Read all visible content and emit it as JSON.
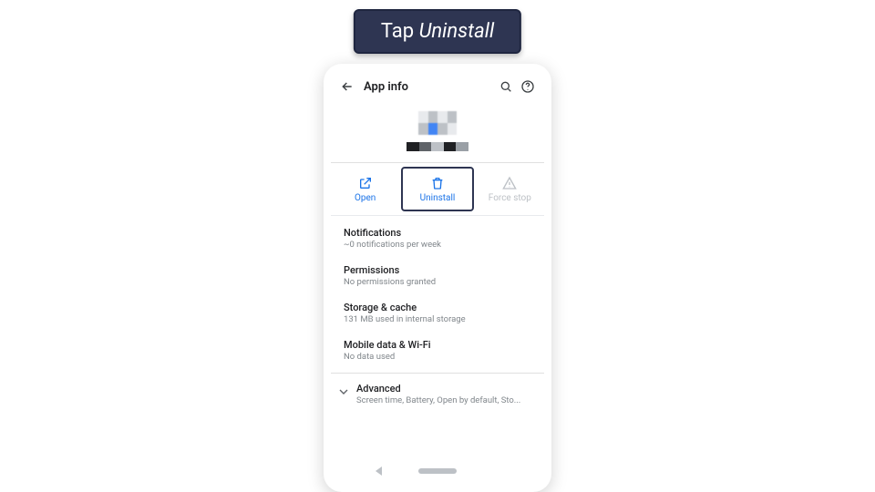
{
  "callout": {
    "prefix": "Tap ",
    "emph": "Uninstall"
  },
  "appbar": {
    "title": "App info"
  },
  "actions": {
    "open": "Open",
    "uninstall": "Uninstall",
    "forcestop": "Force stop"
  },
  "entries": {
    "notifications": {
      "title": "Notifications",
      "sub": "~0 notifications per week"
    },
    "permissions": {
      "title": "Permissions",
      "sub": "No permissions granted"
    },
    "storage": {
      "title": "Storage & cache",
      "sub": "131 MB used in internal storage"
    },
    "mobile": {
      "title": "Mobile data & Wi-Fi",
      "sub": "No data used"
    },
    "advanced": {
      "title": "Advanced",
      "sub": "Screen time, Battery, Open by default, Sto..."
    }
  }
}
